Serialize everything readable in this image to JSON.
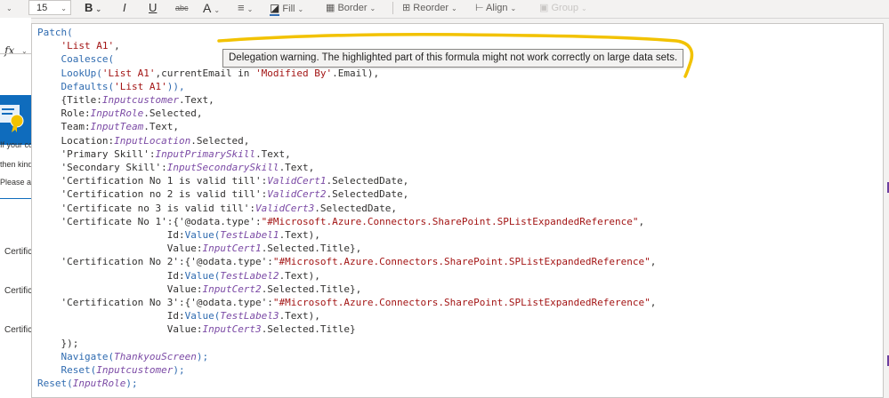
{
  "toolbar": {
    "font_size": "15",
    "bold": "B",
    "italic": "I",
    "underline": "U",
    "strike": "abc",
    "font_color": "A",
    "fill_label": "Fill",
    "border_label": "Border",
    "reorder_label": "Reorder",
    "align_label": "Align",
    "group_label": "Group"
  },
  "formula_bar": {
    "fx": "fx"
  },
  "left_pane": {
    "snippet_lines": [
      "If your co",
      "then kind",
      "Please al"
    ],
    "cert_labels": [
      "Certific",
      "Certific",
      "Certific"
    ]
  },
  "tooltip": {
    "text": "Delegation warning. The highlighted part of this formula might not work correctly on large data sets."
  },
  "code": {
    "l1": "Patch(",
    "l2_str": "'List A1'",
    "l3_fn": "Coalesce(",
    "l4_fn": "LookUp(",
    "l4_str": "'List A1'",
    "l4_rest": ",currentEmail in ",
    "l4_str2": "'Modified By'",
    "l4_end": ".Email),",
    "l5_fn": "Defaults(",
    "l5_str": "'List A1'",
    "l5_end": ")),",
    "l6a": "{Title:",
    "l6_ctl": "Inputcustomer",
    "l6_end": ".Text,",
    "l7a": "Role:",
    "l7_ctl": "InputRole",
    "l7_end": ".Selected,",
    "l8a": "Team:",
    "l8_ctl": "InputTeam",
    "l8_end": ".Text,",
    "l9a": "Location:",
    "l9_ctl": "InputLocation",
    "l9_end": ".Selected,",
    "l10a": "'Primary Skill':",
    "l10_ctl": "InputPrimarySkill",
    "l10_end": ".Text,",
    "l11a": "'Secondary Skill':",
    "l11_ctl": "InputSecondarySkill",
    "l11_end": ".Text,",
    "l12a": "'Certification No 1 is valid till':",
    "l12_ctl": "ValidCert1",
    "l12_end": ".SelectedDate,",
    "l13a": "'Certification no 2 is valid till':",
    "l13_ctl": "ValidCert2",
    "l13_end": ".SelectedDate,",
    "l14a": "'Certificate no 3 is valid till':",
    "l14_ctl": "ValidCert3",
    "l14_end": ".SelectedDate,",
    "l15a": "'Certificate No 1':{'@odata.type':",
    "odata": "\"#Microsoft.Azure.Connectors.SharePoint.SPListExpandedReference\"",
    "comma": ",",
    "id_pre": "Id:",
    "value_fn": "Value(",
    "l16_ctl": "TestLabel1",
    "text_end": ".Text),",
    "val_pre": "Value:",
    "l17_ctl": "InputCert1",
    "sel_title_end": ".Selected.Title},",
    "l18a": "'Certification No 2':{'@odata.type':",
    "l19_ctl": "TestLabel2",
    "l20_ctl": "InputCert2",
    "l21a": "'Certification No 3':{'@odata.type':",
    "l22_ctl": "TestLabel3",
    "l23_ctl": "InputCert3",
    "sel_title_last": ".Selected.Title}",
    "l24": "});",
    "l25_fn": "Navigate(",
    "l25_ctl": "ThankyouScreen",
    "l25_end": ");",
    "l26_fn": "Reset(",
    "l26_ctl": "Inputcustomer",
    "l26_end": ");",
    "l27_fn": "Reset(",
    "l27_ctl": "InputRole",
    "l27_end": ");"
  },
  "colors": {
    "function": "#2f6bb0",
    "string": "#a31515",
    "control": "#7b4aa5",
    "annotation": "#f2c200",
    "app_blue": "#0f6cbd"
  }
}
